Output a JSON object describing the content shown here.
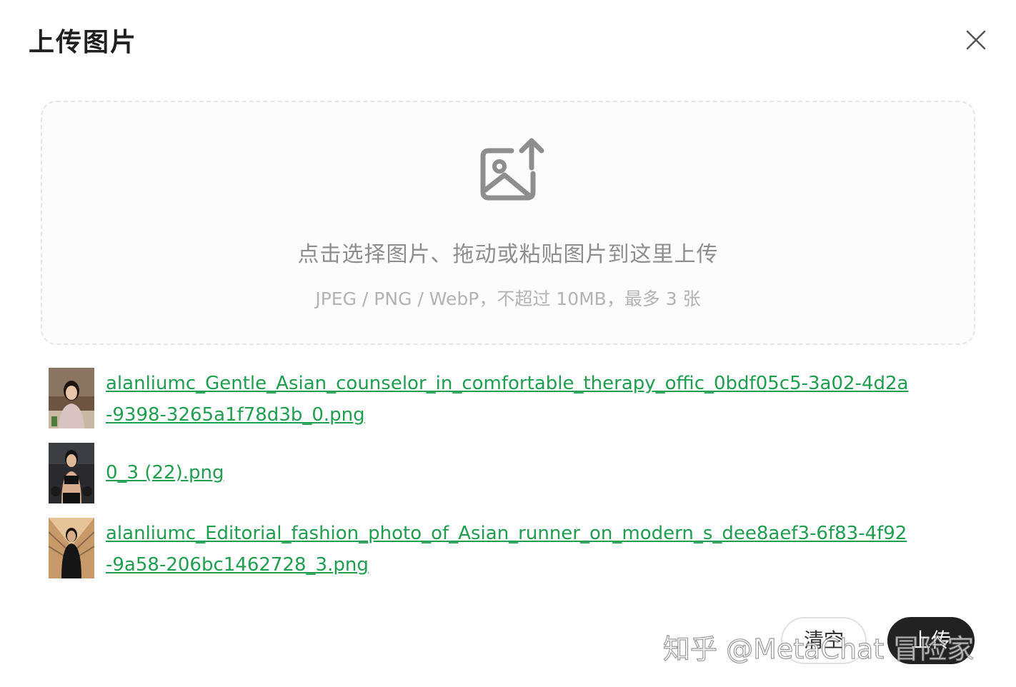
{
  "dialog": {
    "title": "上传图片",
    "close_icon": "close-icon"
  },
  "dropzone": {
    "icon": "image-upload-icon",
    "hint": "点击选择图片、拖动或粘贴图片到这里上传",
    "subhint": "JPEG / PNG / WebP，不超过 10MB，最多 3 张"
  },
  "files": [
    {
      "name": "alanliumc_Gentle_Asian_counselor_in_comfortable_therapy_offic_0bdf05c5-3a02-4d2a-9398-3265a1f78d3b_0.png"
    },
    {
      "name": "0_3 (22).png"
    },
    {
      "name": "alanliumc_Editorial_fashion_photo_of_Asian_runner_on_modern_s_dee8aef3-6f83-4f92-9a58-206bc1462728_3.png"
    }
  ],
  "actions": {
    "clear_label": "清空",
    "upload_label": "上传"
  },
  "watermark": "知乎 @MetaChat 冒险家",
  "colors": {
    "link": "#1e9e4e",
    "primary_button": "#222222"
  }
}
